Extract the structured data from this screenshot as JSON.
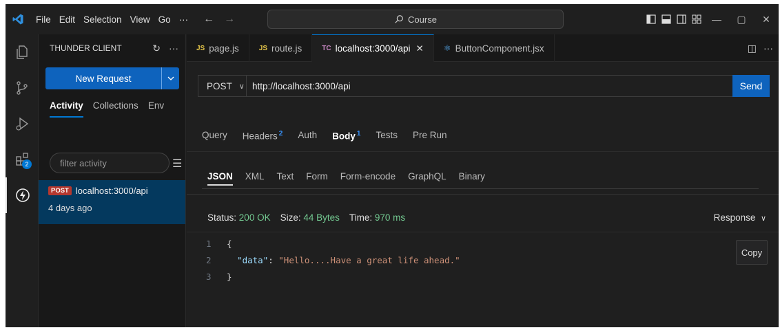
{
  "menu": [
    "File",
    "Edit",
    "Selection",
    "View",
    "Go",
    "···"
  ],
  "command_center": {
    "text": "Course"
  },
  "sidebar": {
    "title": "THUNDER CLIENT",
    "new_request": "New Request",
    "tabs": [
      "Activity",
      "Collections",
      "Env"
    ],
    "filter_placeholder": "filter activity",
    "activity": {
      "method": "POST",
      "url": "localhost:3000/api",
      "time": "4 days ago"
    }
  },
  "activity_bar": {
    "badge": "2"
  },
  "tabs": [
    {
      "badge": "JS",
      "label": "page.js"
    },
    {
      "badge": "JS",
      "label": "route.js"
    },
    {
      "badge": "TC",
      "label": "localhost:3000/api"
    },
    {
      "badge": "react",
      "label": "ButtonComponent.jsx"
    }
  ],
  "request": {
    "method": "POST",
    "url": "http://localhost:3000/api",
    "send": "Send",
    "tabs": [
      {
        "label": "Query",
        "sup": ""
      },
      {
        "label": "Headers",
        "sup": "2"
      },
      {
        "label": "Auth",
        "sup": ""
      },
      {
        "label": "Body",
        "sup": "1"
      },
      {
        "label": "Tests",
        "sup": ""
      },
      {
        "label": "Pre Run",
        "sup": ""
      }
    ],
    "body_tabs": [
      "JSON",
      "XML",
      "Text",
      "Form",
      "Form-encode",
      "GraphQL",
      "Binary"
    ]
  },
  "response": {
    "status_label": "Status:",
    "status": "200 OK",
    "size_label": "Size:",
    "size": "44 Bytes",
    "time_label": "Time:",
    "time": "970 ms",
    "dropdown": "Response",
    "copy": "Copy",
    "lines": [
      {
        "n": "1",
        "text": "{"
      },
      {
        "n": "2",
        "key": "\"data\"",
        "sep": ": ",
        "value": "\"Hello....Have a great life ahead.\""
      },
      {
        "n": "3",
        "text": "}"
      }
    ]
  }
}
